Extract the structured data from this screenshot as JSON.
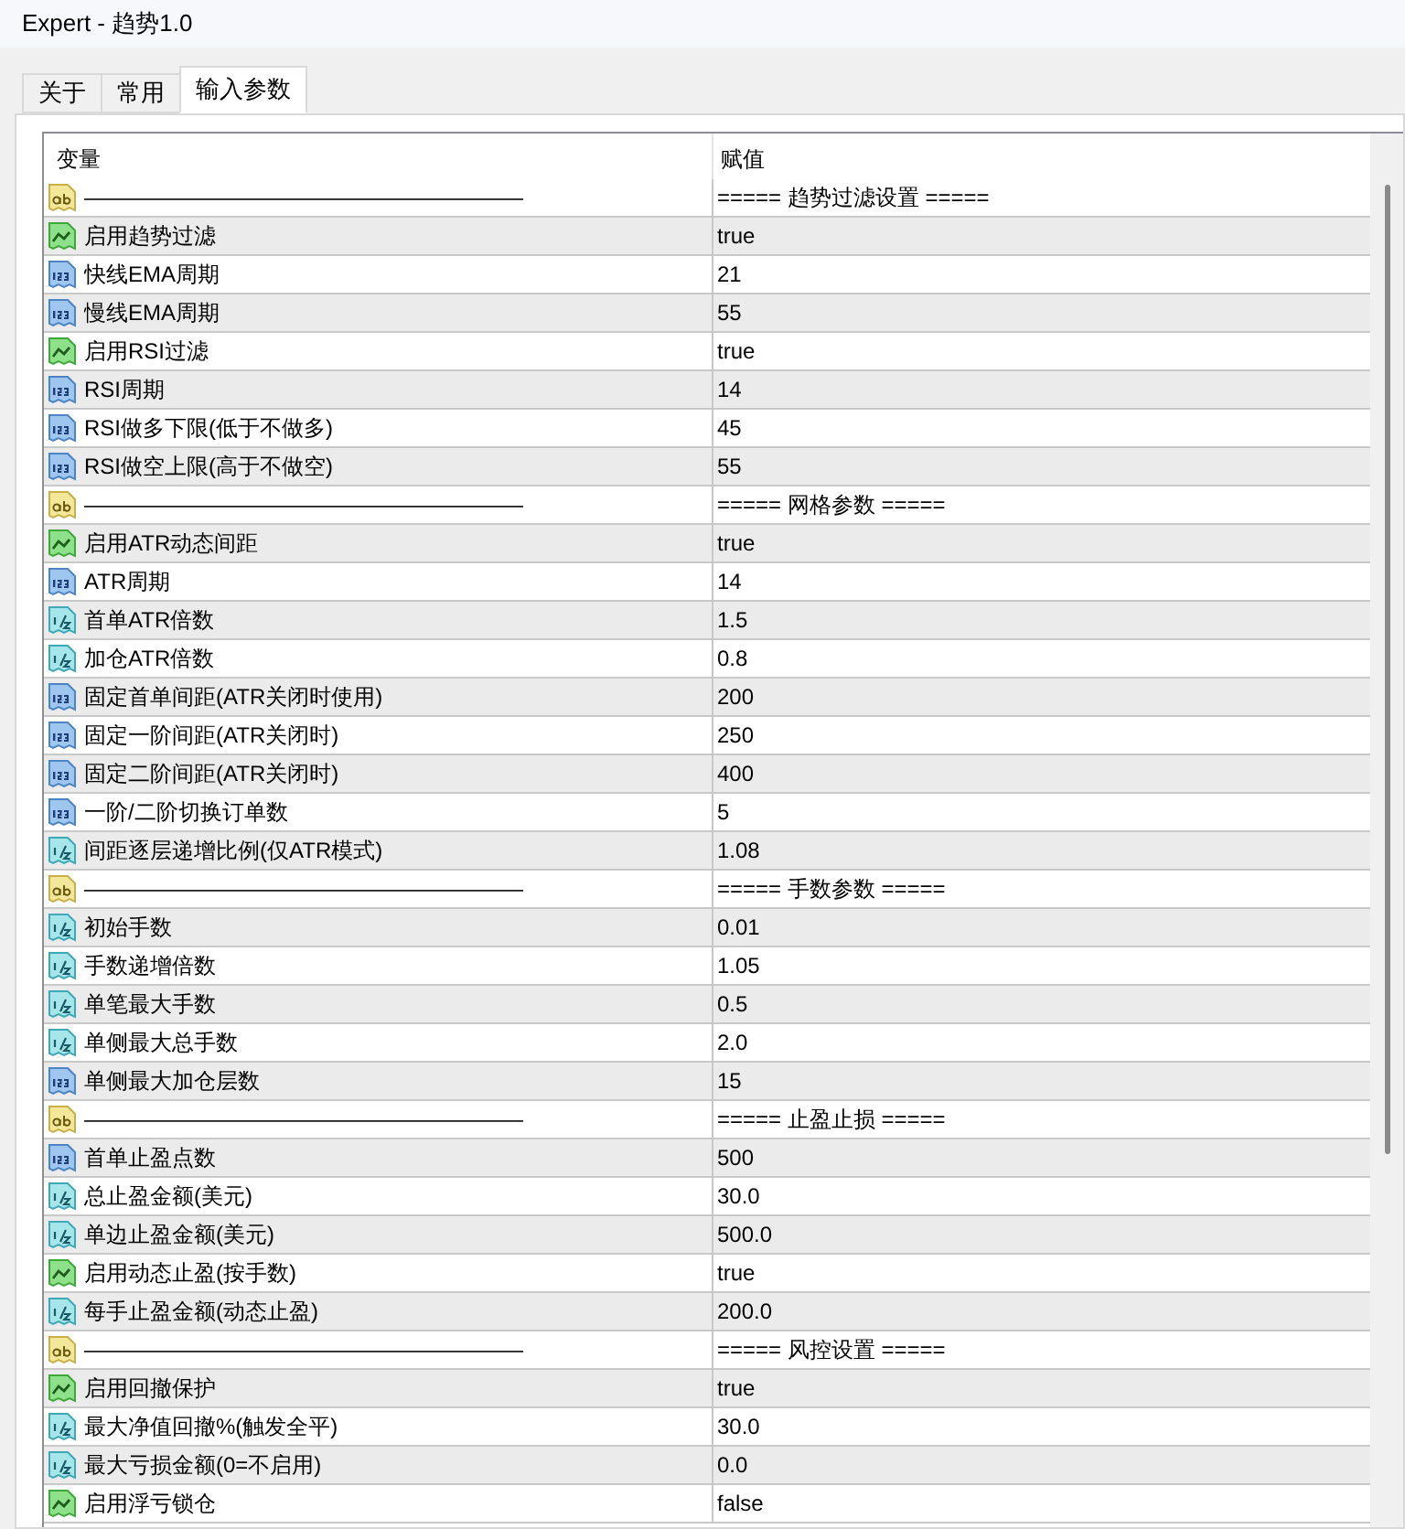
{
  "window": {
    "title": "Expert - 趋势1.0"
  },
  "tabs": [
    {
      "label": "关于",
      "selected": false
    },
    {
      "label": "常用",
      "selected": false
    },
    {
      "label": "输入参数",
      "selected": true
    }
  ],
  "table": {
    "columns": [
      "变量",
      "赋值"
    ],
    "rows": [
      {
        "kind": "string",
        "name": "————————————————————",
        "value": "===== 趋势过滤设置 ====="
      },
      {
        "kind": "bool",
        "name": "启用趋势过滤",
        "value": "true"
      },
      {
        "kind": "int",
        "name": "快线EMA周期",
        "value": "21"
      },
      {
        "kind": "int",
        "name": "慢线EMA周期",
        "value": "55"
      },
      {
        "kind": "bool",
        "name": "启用RSI过滤",
        "value": "true"
      },
      {
        "kind": "int",
        "name": "RSI周期",
        "value": "14"
      },
      {
        "kind": "int",
        "name": "RSI做多下限(低于不做多)",
        "value": "45"
      },
      {
        "kind": "int",
        "name": "RSI做空上限(高于不做空)",
        "value": "55"
      },
      {
        "kind": "string",
        "name": "————————————————————",
        "value": "===== 网格参数 ====="
      },
      {
        "kind": "bool",
        "name": "启用ATR动态间距",
        "value": "true"
      },
      {
        "kind": "int",
        "name": "ATR周期",
        "value": "14"
      },
      {
        "kind": "double",
        "name": "首单ATR倍数",
        "value": "1.5"
      },
      {
        "kind": "double",
        "name": "加仓ATR倍数",
        "value": "0.8"
      },
      {
        "kind": "int",
        "name": "固定首单间距(ATR关闭时使用)",
        "value": "200"
      },
      {
        "kind": "int",
        "name": "固定一阶间距(ATR关闭时)",
        "value": "250"
      },
      {
        "kind": "int",
        "name": "固定二阶间距(ATR关闭时)",
        "value": "400"
      },
      {
        "kind": "int",
        "name": "一阶/二阶切换订单数",
        "value": "5"
      },
      {
        "kind": "double",
        "name": "间距逐层递增比例(仅ATR模式)",
        "value": "1.08"
      },
      {
        "kind": "string",
        "name": "————————————————————",
        "value": "===== 手数参数 ====="
      },
      {
        "kind": "double",
        "name": "初始手数",
        "value": "0.01"
      },
      {
        "kind": "double",
        "name": "手数递增倍数",
        "value": "1.05"
      },
      {
        "kind": "double",
        "name": "单笔最大手数",
        "value": "0.5"
      },
      {
        "kind": "double",
        "name": "单侧最大总手数",
        "value": "2.0"
      },
      {
        "kind": "int",
        "name": "单侧最大加仓层数",
        "value": "15"
      },
      {
        "kind": "string",
        "name": "————————————————————",
        "value": "===== 止盈止损 ====="
      },
      {
        "kind": "int",
        "name": "首单止盈点数",
        "value": "500"
      },
      {
        "kind": "double",
        "name": "总止盈金额(美元)",
        "value": "30.0"
      },
      {
        "kind": "double",
        "name": "单边止盈金额(美元)",
        "value": "500.0"
      },
      {
        "kind": "bool",
        "name": "启用动态止盈(按手数)",
        "value": "true"
      },
      {
        "kind": "double",
        "name": "每手止盈金额(动态止盈)",
        "value": "200.0"
      },
      {
        "kind": "string",
        "name": "————————————————————",
        "value": "===== 风控设置 ====="
      },
      {
        "kind": "bool",
        "name": "启用回撤保护",
        "value": "true"
      },
      {
        "kind": "double",
        "name": "最大净值回撤%(触发全平)",
        "value": "30.0"
      },
      {
        "kind": "double",
        "name": "最大亏损金额(0=不启用)",
        "value": "0.0"
      },
      {
        "kind": "bool",
        "name": "启用浮亏锁仓",
        "value": "false"
      }
    ]
  }
}
